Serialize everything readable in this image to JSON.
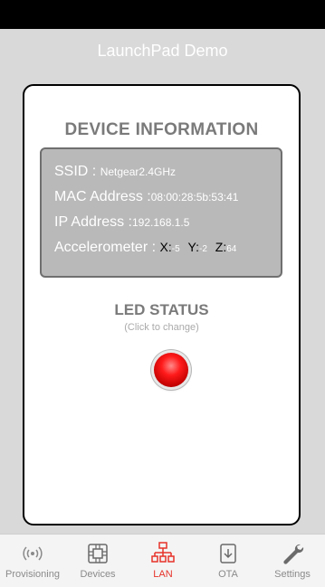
{
  "app": {
    "title": "LaunchPad Demo"
  },
  "device_info": {
    "heading": "DEVICE INFORMATION",
    "ssid_label": "SSID :",
    "ssid_value": "Netgear2.4GHz",
    "mac_label": "MAC Address :",
    "mac_value": "08:00:28:5b:53:41",
    "ip_label": "IP Address :",
    "ip_value": "192.168.1.5",
    "accel_label": "Accelerometer :",
    "accel_x_label": "X:",
    "accel_x_value": "-5",
    "accel_y_label": "Y:",
    "accel_y_value": "-2",
    "accel_z_label": "Z:",
    "accel_z_value": "64"
  },
  "led": {
    "heading": "LED STATUS",
    "hint": "(Click to change)",
    "state_color": "#ff1a1a"
  },
  "tabs": [
    {
      "label": "Provisioning",
      "icon": "wifi-signal-icon",
      "active": false
    },
    {
      "label": "Devices",
      "icon": "chip-icon",
      "active": false
    },
    {
      "label": "LAN",
      "icon": "network-icon",
      "active": true
    },
    {
      "label": "OTA",
      "icon": "download-icon",
      "active": false
    },
    {
      "label": "Settings",
      "icon": "wrench-icon",
      "active": false
    }
  ],
  "colors": {
    "accent": "#e6332a",
    "inactive": "#8a8a8a",
    "panel": "#b9b9b9"
  }
}
